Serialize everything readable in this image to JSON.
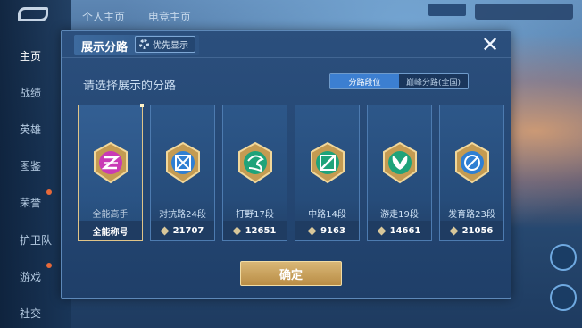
{
  "sidebar": {
    "items": [
      {
        "label": "主页",
        "active": true
      },
      {
        "label": "战绩",
        "active": false
      },
      {
        "label": "英雄",
        "active": false
      },
      {
        "label": "图鉴",
        "active": false
      },
      {
        "label": "荣誉",
        "active": false
      },
      {
        "label": "护卫队",
        "active": false
      },
      {
        "label": "游戏",
        "active": false
      },
      {
        "label": "社交",
        "active": false
      }
    ]
  },
  "top_tabs": [
    "个人主页",
    "电竞主页"
  ],
  "modal": {
    "title": "展示分路",
    "priority_label": "优先显示",
    "prompt": "请选择展示的分路",
    "segments": [
      {
        "label": "分路段位",
        "active": true
      },
      {
        "label": "巅峰分路(全国)",
        "active": false
      }
    ],
    "cards": [
      {
        "label": "全能高手",
        "bottom": "全能称号",
        "selected": true,
        "emblem_color": "#c93ab5",
        "show_diamond": false
      },
      {
        "label": "对抗路24段",
        "bottom": "21707",
        "selected": false,
        "emblem_color": "#2f7fd3",
        "show_diamond": true
      },
      {
        "label": "打野17段",
        "bottom": "12651",
        "selected": false,
        "emblem_color": "#1fa37a",
        "show_diamond": true
      },
      {
        "label": "中路14段",
        "bottom": "9163",
        "selected": false,
        "emblem_color": "#1fa37a",
        "show_diamond": true
      },
      {
        "label": "游走19段",
        "bottom": "14661",
        "selected": false,
        "emblem_color": "#1fa37a",
        "show_diamond": true
      },
      {
        "label": "发育路23段",
        "bottom": "21056",
        "selected": false,
        "emblem_color": "#2f7fd3",
        "show_diamond": true
      }
    ],
    "confirm_label": "确定"
  },
  "colors": {
    "accent_gold": "#d9b777",
    "segment_active": "#3c7fd1"
  },
  "icons": [
    "close-icon",
    "gear-icon",
    "diamond-icon"
  ]
}
